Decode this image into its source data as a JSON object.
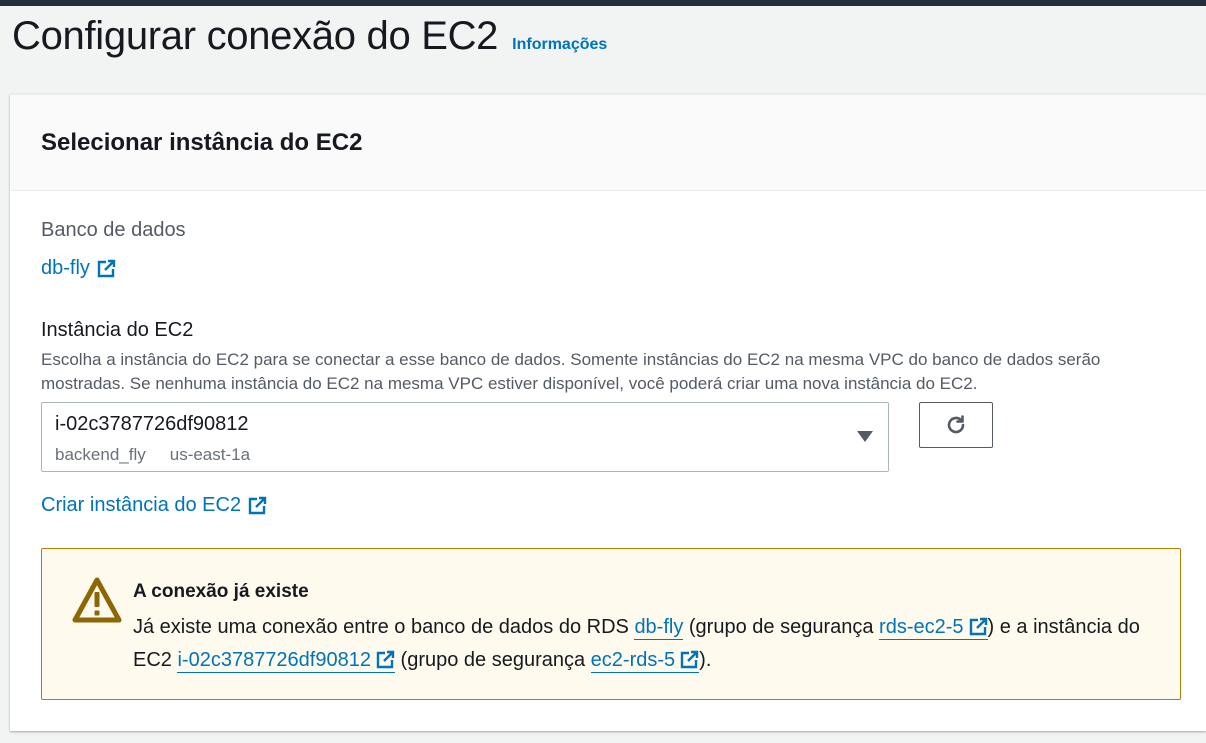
{
  "header": {
    "title": "Configurar conexão do EC2",
    "info_link": "Informações"
  },
  "panel": {
    "title": "Selecionar instância do EC2",
    "database": {
      "label": "Banco de dados",
      "link": "db-fly",
      "link_icon": "external-link-icon"
    },
    "ec2": {
      "label": "Instância do EC2",
      "description": "Escolha a instância do EC2 para se conectar a esse banco de dados. Somente instâncias do EC2 na mesma VPC do banco de dados serão mostradas. Se nenhuma instância do EC2 na mesma VPC estiver disponível, você poderá criar uma nova instância do EC2.",
      "selected": {
        "id": "i-02c3787726df90812",
        "name": "backend_fly",
        "az": "us-east-1a"
      },
      "refresh_icon": "refresh-icon",
      "create_link": "Criar instância do EC2"
    },
    "alert": {
      "icon": "warning-icon",
      "title": "A conexão já existe",
      "text_1": "Já existe uma conexão entre o banco de dados do RDS ",
      "db_link": "db-fly",
      "text_2": " (grupo de segurança ",
      "sg_rds": "rds-ec2-5",
      "text_3": ") e a instância do EC2 ",
      "instance_link": "i-02c3787726df90812",
      "text_4": " (grupo de segurança ",
      "sg_ec2": "ec2-rds-5",
      "text_5": ")."
    }
  },
  "colors": {
    "link": "#0073bb",
    "warning_border": "#b27f00",
    "warning_bg": "#fefaed",
    "topbar": "#232f3e"
  }
}
